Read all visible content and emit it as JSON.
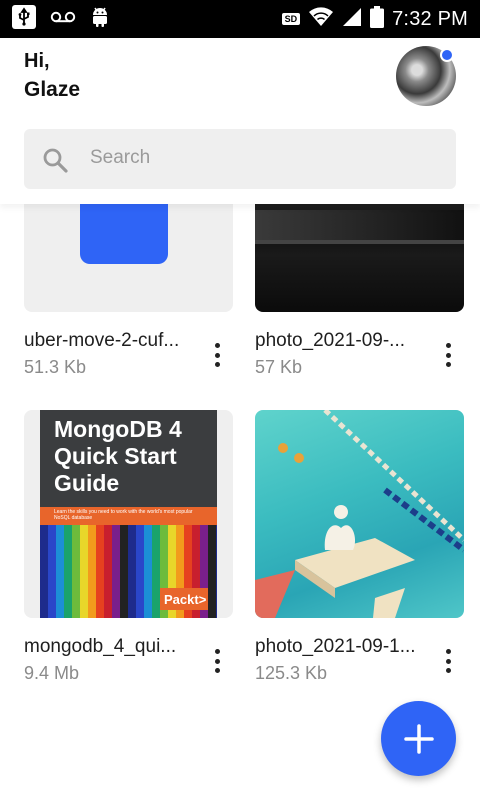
{
  "status_bar": {
    "time": "7:32 PM",
    "sd_label": "SD"
  },
  "header": {
    "greeting": "Hi,",
    "username": "Glaze"
  },
  "search": {
    "placeholder": "Search"
  },
  "files": [
    {
      "name": "uber-move-2-cuf...",
      "size": "51.3 Kb"
    },
    {
      "name": "photo_2021-09-...",
      "size": "57 Kb"
    },
    {
      "name": "mongodb_4_qui...",
      "size": "9.4 Mb"
    },
    {
      "name": "photo_2021-09-1...",
      "size": "125.3 Kb"
    }
  ],
  "book_cover": {
    "title_line1": "MongoDB 4",
    "title_line2": "Quick Start",
    "title_line3": "Guide",
    "tagline": "Learn the skills you need to work with the world's most popular NoSQL database",
    "publisher": "Packt>"
  },
  "colors": {
    "accent": "#2f64f6",
    "text": "#1f1f1f",
    "muted": "#8a8a8a"
  },
  "icons": [
    "usb-icon",
    "voicemail-icon",
    "android-icon",
    "sd-card-icon",
    "wifi-icon",
    "signal-icon",
    "battery-icon",
    "search-icon",
    "more-vert-icon",
    "plus-icon"
  ]
}
